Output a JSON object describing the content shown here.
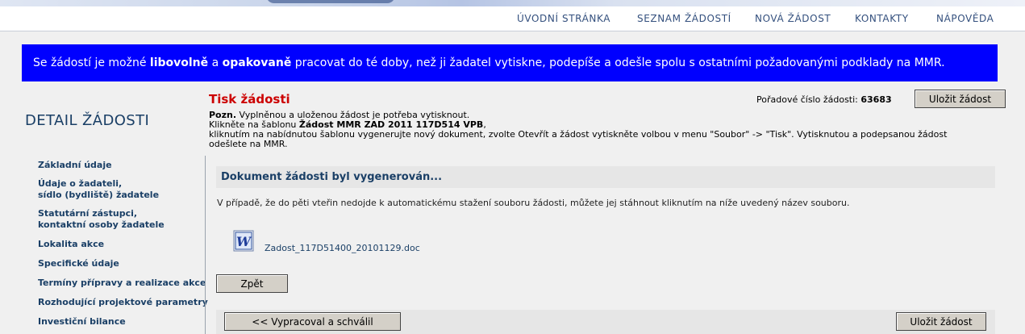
{
  "nav": {
    "items": [
      "ÚVODNÍ STRÁNKA",
      "SEZNAM ŽÁDOSTÍ",
      "NOVÁ ŽÁDOST",
      "KONTAKTY",
      "NÁPOVĚDA"
    ]
  },
  "info_bar": {
    "part1": "Se žádostí je možné ",
    "bold1": "libovolně",
    "part2": " a ",
    "bold2": "opakovaně",
    "part3": " pracovat do té doby, než ji žadatel vytiskne, podepíše a odešle spolu s ostatními požadovanými podklady na MMR."
  },
  "sidebar": {
    "title": "DETAIL ŽÁDOSTI",
    "items": [
      {
        "line1": "Základní údaje",
        "line2": ""
      },
      {
        "line1": "Údaje o žadateli,",
        "line2": "sídlo (bydliště) žadatele"
      },
      {
        "line1": "Statutární zástupci,",
        "line2": "kontaktní osoby žadatele"
      },
      {
        "line1": "Lokalita akce",
        "line2": ""
      },
      {
        "line1": "Specifické údaje",
        "line2": ""
      },
      {
        "line1": "Termíny přípravy a realizace akce",
        "line2": ""
      },
      {
        "line1": "Rozhodující projektové parametry",
        "line2": ""
      },
      {
        "line1": "Investiční bilance",
        "line2": ""
      }
    ]
  },
  "main": {
    "title": "Tisk žádosti",
    "order_label": "Pořadové číslo žádosti:",
    "order_number": "63683",
    "save_label": "Uložit žádost",
    "note": {
      "prefix": "Pozn.",
      "line1": " Vyplněnou a uloženou žádost je potřeba vytisknout.",
      "line2_a": "Klikněte na šablonu ",
      "line2_b": "Žádost MMR ZAD 2011 117D514 VPB",
      "line2_c": ",",
      "line3": "kliknutím na nabídnutou šablonu vygenerujte nový dokument, zvolte Otevřít a žádost vytiskněte volbou v menu \"Soubor\" -> \"Tisk\". Vytisknutou a podepsanou žádost",
      "line4": "odešlete na MMR."
    },
    "panel_title": "Dokument žádosti byl vygenerován...",
    "panel_info": "V případě, že do pěti vteřin nedojde k automatickému stažení souboru žádosti, můžete jej stáhnout kliknutím na níže uvedený název souboru.",
    "file_name": "Zadost_117D51400_20101129.doc",
    "back_label": "Zpět",
    "prev_label": "<<  Vypracoval a schválil",
    "save_bottom_label": "Uložit žádost"
  },
  "colors": {
    "info_bar_bg": "#0000ff",
    "title_red": "#cc0000",
    "nav_text": "#34507e",
    "sidebar_text": "#1a3f66"
  },
  "icons": {
    "file": "word-document-icon"
  }
}
